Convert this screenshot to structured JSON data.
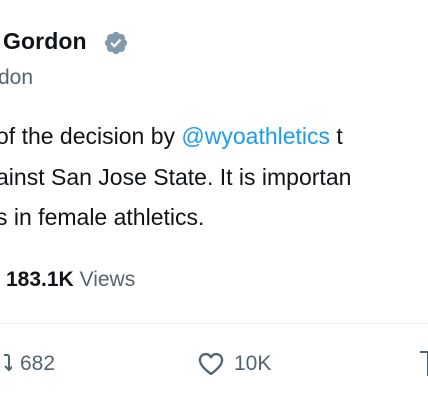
{
  "author": {
    "name": "Gordon",
    "name_prefix_visible": ".",
    "handle": "don"
  },
  "tweet": {
    "line1_pre": "of the decision by ",
    "line1_mention": "@wyoathletics",
    "line1_post": " t",
    "line2": "ainst San Jose State. It is importan",
    "line3": "s in female athletics."
  },
  "stats": {
    "views_count": "183.1K",
    "views_label": "Views"
  },
  "actions": {
    "retweet_count": "682",
    "like_count": "10K"
  },
  "icons": [
    "verified-badge-icon",
    "retweet-icon",
    "heart-icon",
    "bookmark-icon"
  ],
  "colors": {
    "accent": "#1d9bf0",
    "muted": "#536471",
    "text": "#0f1419"
  }
}
